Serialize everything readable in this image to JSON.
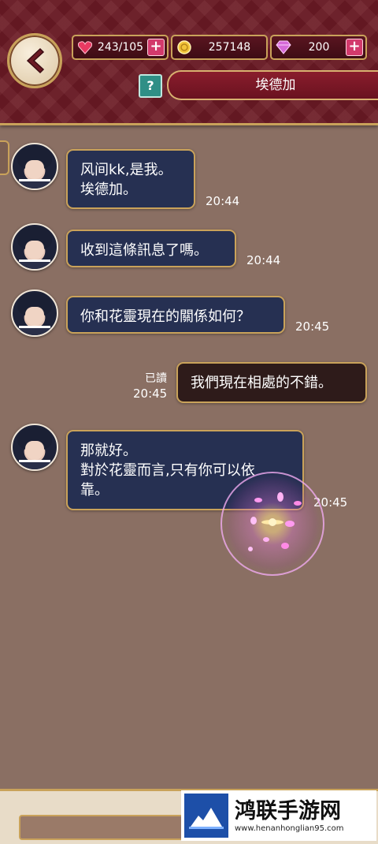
{
  "header": {
    "stamina": "243/105",
    "coins": "257148",
    "gems": "200",
    "help_label": "?",
    "contact_name": "埃德加"
  },
  "messages": [
    {
      "lines": [
        "风间kk,是我。",
        "埃德加。"
      ],
      "time": "20:44"
    },
    {
      "lines": [
        "收到這條訊息了嗎。"
      ],
      "time": "20:44"
    },
    {
      "lines": [
        "你和花靈現在的關係如何？"
      ],
      "time": "20:45"
    },
    {
      "lines": [
        "我們現在相處的不錯。"
      ],
      "time": "20:45",
      "read": "已讀"
    },
    {
      "lines": [
        "那就好。",
        "對於花靈而言,只有你可以依",
        "靠。"
      ],
      "time": "20:45"
    }
  ],
  "watermark": {
    "title": "鸿联手游网",
    "url": "www.henanhonglian95.com"
  },
  "colors": {
    "header_bg": "#6b1a24",
    "chat_bg": "#8a6f63",
    "bubble_other": "#263052",
    "bubble_mine": "#2e1b1a",
    "gold_border": "#c9a25a"
  }
}
